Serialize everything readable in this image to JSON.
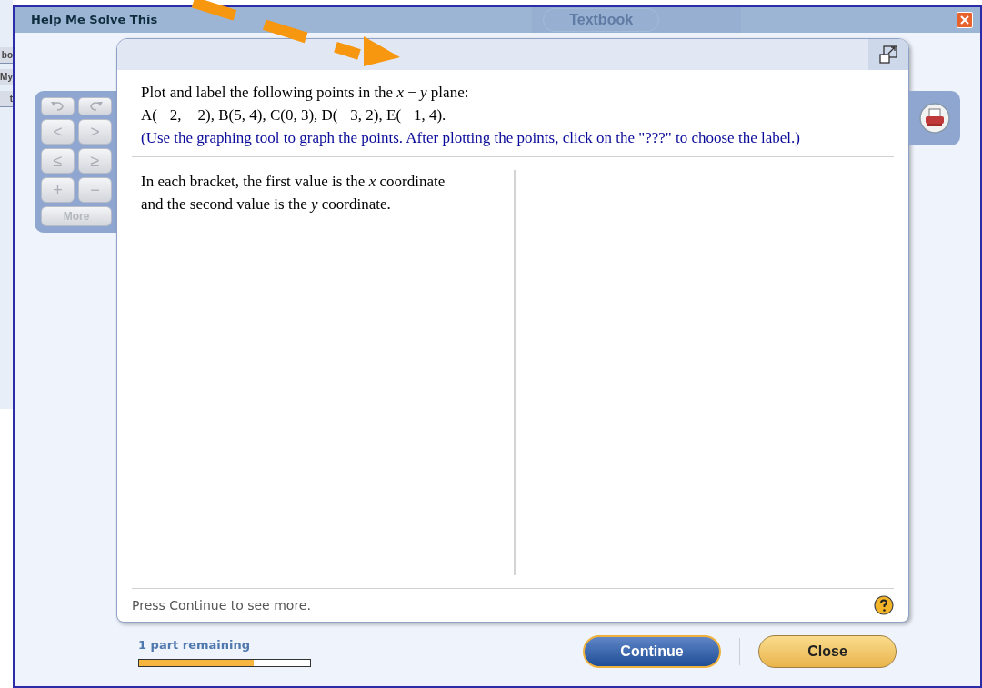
{
  "background": {
    "sidebar_fragments": [
      "bo",
      "My",
      "t"
    ],
    "toolbar_button": "Textbook"
  },
  "window": {
    "title": "Help Me Solve This"
  },
  "keypad": {
    "keys": [
      {
        "kind": "undo",
        "disabled": true
      },
      {
        "kind": "redo",
        "disabled": true
      },
      {
        "kind": "text",
        "label": "<",
        "disabled": true
      },
      {
        "kind": "text",
        "label": ">",
        "disabled": true
      },
      {
        "kind": "text",
        "label": "≤",
        "disabled": true
      },
      {
        "kind": "text",
        "label": "≥",
        "disabled": true
      },
      {
        "kind": "text",
        "label": "+",
        "disabled": true
      },
      {
        "kind": "text",
        "label": "−",
        "disabled": true
      }
    ],
    "more": {
      "label": "More",
      "disabled": true
    }
  },
  "question": {
    "lines": [
      "Plot and label the following points in the *x* − *y* plane:",
      "A(− 2,  − 2), B(5, 4), C(0, 3), D(− 3, 2), E(− 1, 4)."
    ],
    "instruction": "(Use the graphing tool to graph the points. After plotting the points, click on the \"???\" to choose the label.)"
  },
  "help_text": "In each bracket, the first value is the *x* coordinate and the second value is the *y* coordinate.",
  "footer_text": "Press Continue to see more.",
  "progress": {
    "label": "1 part remaining",
    "level": 0.67
  },
  "buttons": [
    {
      "kind": "primary",
      "label": "Continue"
    },
    {
      "kind": "secondary",
      "label": "Close"
    }
  ]
}
